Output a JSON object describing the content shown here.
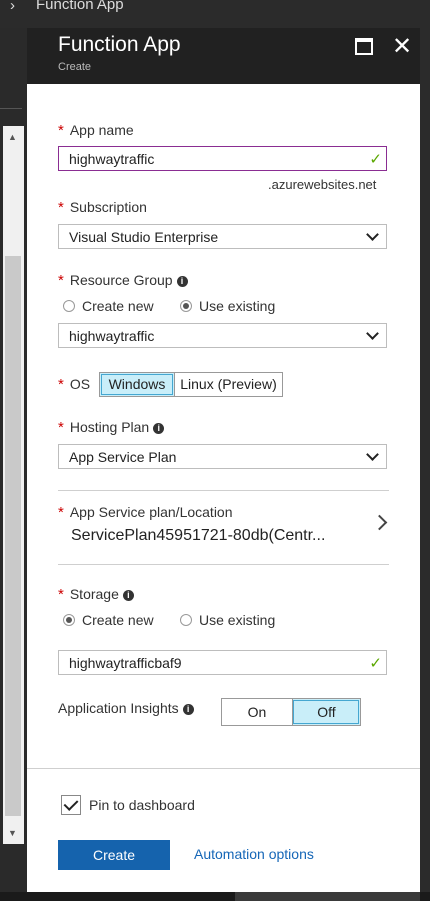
{
  "breadcrumb": {
    "current": "Function App"
  },
  "blade": {
    "title": "Function App",
    "subtitle": "Create",
    "maximize_icon": "maximize-icon",
    "close_icon": "close-icon"
  },
  "form": {
    "app_name": {
      "label": "App name",
      "value": "highwaytraffic",
      "suffix": ".azurewebsites.net"
    },
    "subscription": {
      "label": "Subscription",
      "value": "Visual Studio Enterprise"
    },
    "resource_group": {
      "label": "Resource Group",
      "option_create": "Create new",
      "option_existing": "Use existing",
      "selected": "Use existing",
      "value": "highwaytraffic"
    },
    "os": {
      "label": "OS",
      "options": [
        "Windows",
        "Linux (Preview)"
      ],
      "selected": "Windows"
    },
    "hosting_plan": {
      "label": "Hosting Plan",
      "value": "App Service Plan"
    },
    "service_plan": {
      "label": "App Service plan/Location",
      "value": "ServicePlan45951721-80db(Centr..."
    },
    "storage": {
      "label": "Storage",
      "option_create": "Create new",
      "option_existing": "Use existing",
      "selected": "Create new",
      "value": "highwaytrafficbaf9"
    },
    "app_insights": {
      "label": "Application Insights",
      "on": "On",
      "off": "Off",
      "selected": "Off"
    }
  },
  "footer": {
    "pin_label": "Pin to dashboard",
    "pin_checked": true,
    "create_button": "Create",
    "automation_link": "Automation options"
  },
  "colors": {
    "accent": "#1563ad",
    "required": "#cc0000",
    "valid_check": "#5aa700",
    "selected_toggle": "#c9eef9",
    "focus_border": "#8a2d92"
  }
}
